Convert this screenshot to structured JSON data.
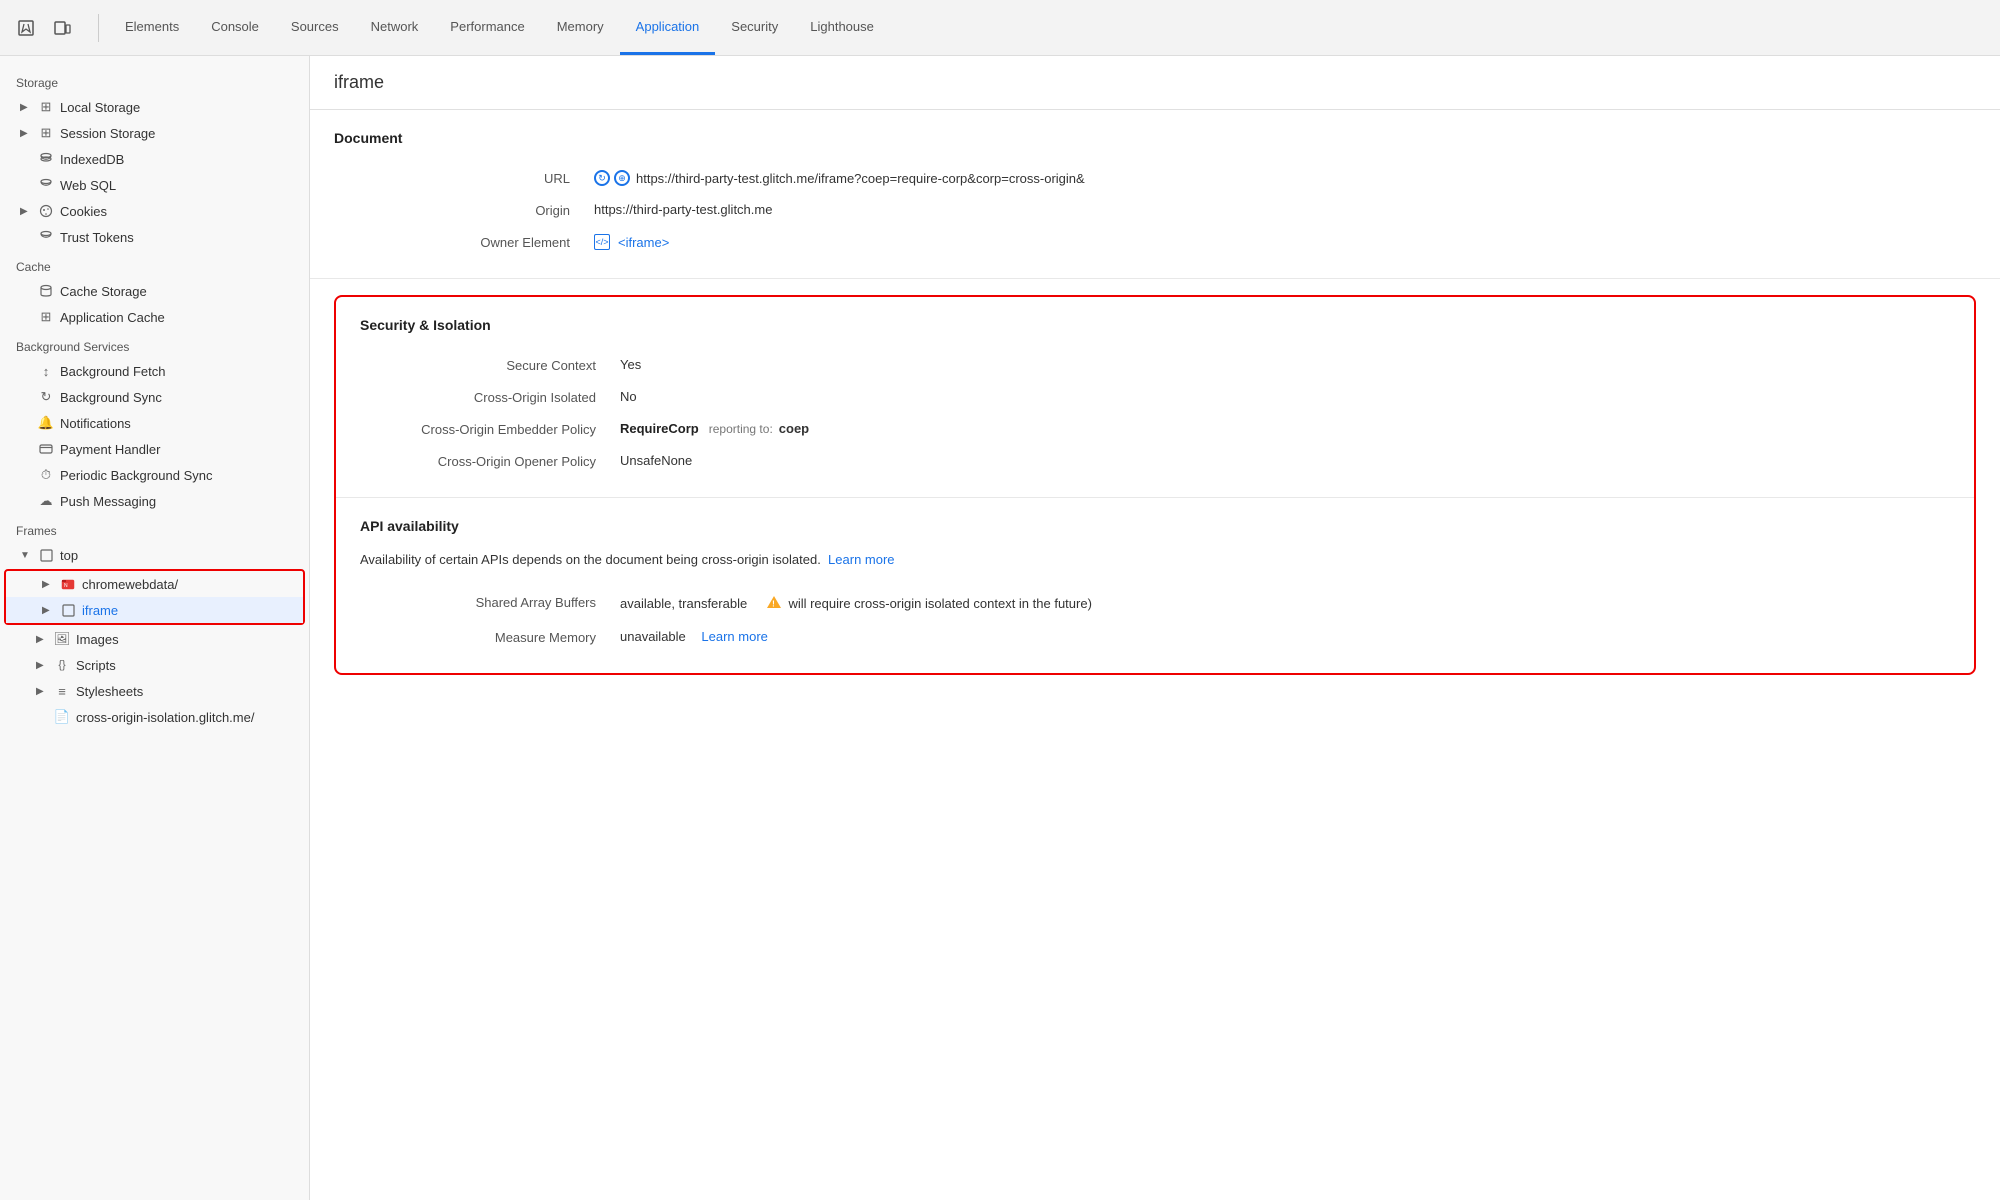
{
  "toolbar": {
    "inspect_icon": "⬚",
    "device_icon": "📱",
    "tabs": [
      {
        "id": "elements",
        "label": "Elements",
        "active": false
      },
      {
        "id": "console",
        "label": "Console",
        "active": false
      },
      {
        "id": "sources",
        "label": "Sources",
        "active": false
      },
      {
        "id": "network",
        "label": "Network",
        "active": false
      },
      {
        "id": "performance",
        "label": "Performance",
        "active": false
      },
      {
        "id": "memory",
        "label": "Memory",
        "active": false
      },
      {
        "id": "application",
        "label": "Application",
        "active": true
      },
      {
        "id": "security",
        "label": "Security",
        "active": false
      },
      {
        "id": "lighthouse",
        "label": "Lighthouse",
        "active": false
      }
    ]
  },
  "sidebar": {
    "storage_label": "Storage",
    "cache_label": "Cache",
    "bg_services_label": "Background Services",
    "frames_label": "Frames",
    "items": {
      "local_storage": "Local Storage",
      "session_storage": "Session Storage",
      "indexed_db": "IndexedDB",
      "web_sql": "Web SQL",
      "cookies": "Cookies",
      "trust_tokens": "Trust Tokens",
      "cache_storage": "Cache Storage",
      "app_cache": "Application Cache",
      "bg_fetch": "Background Fetch",
      "bg_sync": "Background Sync",
      "notifications": "Notifications",
      "payment_handler": "Payment Handler",
      "periodic_bg_sync": "Periodic Background Sync",
      "push_messaging": "Push Messaging",
      "top": "top",
      "chromewebdata": "chromewebdata/",
      "iframe": "iframe",
      "images": "Images",
      "scripts": "Scripts",
      "stylesheets": "Stylesheets",
      "cross_origin": "cross-origin-isolation.glitch.me/"
    }
  },
  "content": {
    "page_title": "iframe",
    "document_section": "Document",
    "url_label": "URL",
    "url_value": "https://third-party-test.glitch.me/iframe?coep=require-corp&corp=cross-origin&",
    "origin_label": "Origin",
    "origin_value": "https://third-party-test.glitch.me",
    "owner_element_label": "Owner Element",
    "owner_element_value": "<iframe>",
    "security_section": "Security & Isolation",
    "secure_context_label": "Secure Context",
    "secure_context_value": "Yes",
    "cross_origin_isolated_label": "Cross-Origin Isolated",
    "cross_origin_isolated_value": "No",
    "coep_label": "Cross-Origin Embedder Policy",
    "coep_value": "RequireCorp",
    "coep_reporting": "reporting to:",
    "coep_reporting_value": "coep",
    "coop_label": "Cross-Origin Opener Policy",
    "coop_value": "UnsafeNone",
    "api_availability_section": "API availability",
    "api_description": "Availability of certain APIs depends on the document being cross-origin isolated.",
    "api_learn_more": "Learn more",
    "shared_array_label": "Shared Array Buffers",
    "shared_array_value": "available, transferable",
    "shared_array_note": "will require cross-origin isolated context in the future)",
    "measure_memory_label": "Measure Memory",
    "measure_memory_value": "unavailable",
    "measure_memory_learn": "Learn more"
  }
}
